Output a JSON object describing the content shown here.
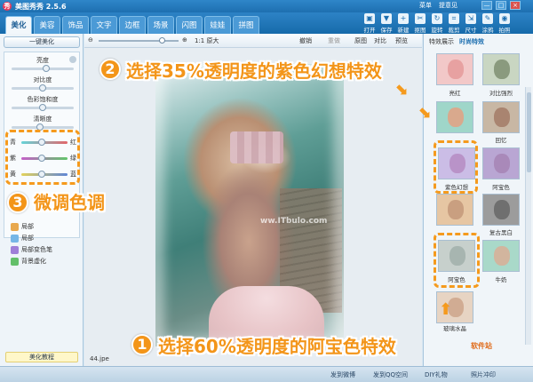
{
  "app": {
    "title": "美图秀秀 2.5.6",
    "logo_glyph": "秀"
  },
  "topmenu": [
    "菜单",
    "提意见"
  ],
  "window_buttons": [
    "—",
    "□",
    "×"
  ],
  "tabs": [
    "美化",
    "美容",
    "饰品",
    "文字",
    "边框",
    "场景",
    "闪图",
    "娃娃",
    "拼图"
  ],
  "active_tab": "美化",
  "tools": [
    {
      "label": "打开",
      "glyph": "▣"
    },
    {
      "label": "保存",
      "glyph": "▼"
    },
    {
      "label": "新建",
      "glyph": "+"
    },
    {
      "label": "抠图",
      "glyph": "✂"
    },
    {
      "label": "旋转",
      "glyph": "↻"
    },
    {
      "label": "裁剪",
      "glyph": "⌗"
    },
    {
      "label": "尺寸",
      "glyph": "⇲"
    },
    {
      "label": "涂鸦",
      "glyph": "✎"
    },
    {
      "label": "拍照",
      "glyph": "◉"
    }
  ],
  "left": {
    "onekey": "一键美化",
    "labels": [
      "亮度",
      "对比度",
      "色彩饱和度",
      "清晰度"
    ],
    "levels": [
      0.55,
      0.5,
      0.5,
      0.45
    ],
    "color_rows": [
      {
        "left": "青",
        "right": "红",
        "level": 0.45
      },
      {
        "left": "紫",
        "right": "绿",
        "level": 0.45
      },
      {
        "left": "黄",
        "right": "蓝",
        "level": 0.45
      }
    ],
    "local_items": [
      "局部",
      "局部",
      "局部变色笔",
      "背景虚化"
    ],
    "tutorial": "美化教程"
  },
  "canvas": {
    "zoom_label": "1:1 原大",
    "toolbar": [
      "撤销",
      "重做",
      "原图",
      "对比",
      "预览"
    ],
    "filename": "44.jpe",
    "watermark": "ww.ITbulo.com"
  },
  "right": {
    "tabs": [
      "特效展示",
      "时尚特效"
    ],
    "thumbs": [
      "亮红",
      "对比强烈",
      "",
      "回忆",
      "紫色幻想",
      "阿宝色",
      "古典",
      "复古黑白",
      "阿宝色",
      "牛奶",
      "玻璃水晶"
    ]
  },
  "status": [
    "发到微博",
    "发到QQ空间",
    "DIY礼物",
    "照片冲印"
  ],
  "annotations": {
    "step1": {
      "num": "1",
      "text": "选择60%透明度的阿宝色特效"
    },
    "step2": {
      "num": "2",
      "text": "选择35%透明度的紫色幻想特效"
    },
    "step3": {
      "num": "3",
      "text": "微调色调"
    }
  },
  "credit": "软件站",
  "colors": {
    "accent": "#f39519",
    "brand_blue": "#1d6fb0"
  }
}
